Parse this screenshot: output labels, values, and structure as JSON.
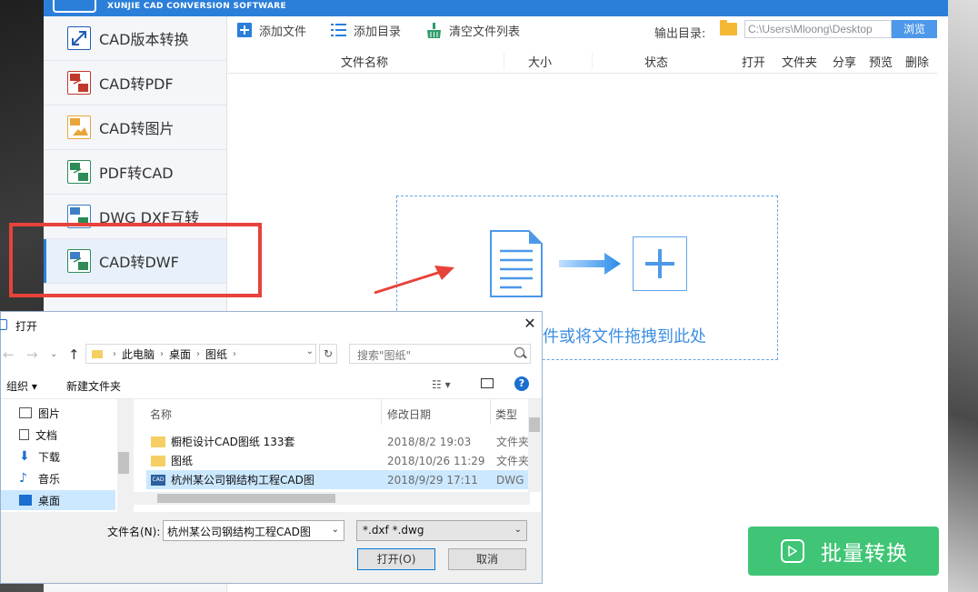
{
  "app": {
    "brand": "XUNJIE CAD CONVERSION SOFTWARE",
    "accent_color": "#2b7fd8"
  },
  "sidebar": {
    "items": [
      {
        "label": "CAD版本转换",
        "icon": "cad-version-icon",
        "icon_text": "",
        "color": "#1f5fb3"
      },
      {
        "label": "CAD转PDF",
        "icon": "cad-to-pdf-icon",
        "icon_text": "CAD PDF",
        "color": "#c0392b"
      },
      {
        "label": "CAD转图片",
        "icon": "cad-to-image-icon",
        "icon_text": "CAD",
        "color": "#e8a53a"
      },
      {
        "label": "PDF转CAD",
        "icon": "pdf-to-cad-icon",
        "icon_text": "PDF CAD",
        "color": "#2e8b57"
      },
      {
        "label": "DWG DXF互转",
        "icon": "dwg-dxf-icon",
        "icon_text": "DWG",
        "color": "#3d7fc4"
      },
      {
        "label": "CAD转DWF",
        "icon": "cad-to-dwf-icon",
        "icon_text": "DWG DWF",
        "color": "#2e8b57",
        "active": true
      }
    ]
  },
  "toolbar": {
    "add_file": "添加文件",
    "add_folder": "添加目录",
    "clear_list": "清空文件列表",
    "output_label": "输出目录:",
    "output_path": "C:\\Users\\Mloong\\Desktop",
    "browse": "浏览"
  },
  "columns": {
    "name": "文件名称",
    "size": "大小",
    "status": "状态",
    "open": "打开",
    "folder": "文件夹",
    "share": "分享",
    "preview": "预览",
    "delete": "删除"
  },
  "drop_zone": {
    "text": "件或将文件拖拽到此处"
  },
  "batch_button": "批量转换",
  "dialog": {
    "title": "打开",
    "breadcrumb": [
      "此电脑",
      "桌面",
      "图纸"
    ],
    "search_placeholder": "搜索\"图纸\"",
    "organize": "组织 ▾",
    "new_folder": "新建文件夹",
    "view_toggle": "▾",
    "help": "?",
    "nav_items": [
      {
        "label": "图片",
        "icon": "pictures-icon"
      },
      {
        "label": "文档",
        "icon": "documents-icon"
      },
      {
        "label": "下载",
        "icon": "downloads-icon"
      },
      {
        "label": "音乐",
        "icon": "music-icon"
      },
      {
        "label": "桌面",
        "icon": "desktop-icon",
        "selected": true
      }
    ],
    "headers": {
      "name": "名称",
      "date": "修改日期",
      "type": "类型"
    },
    "files": [
      {
        "name": "橱柜设计CAD图纸 133套",
        "date": "2018/8/2 19:03",
        "type": "文件夹",
        "icon": "folder-icon"
      },
      {
        "name": "图纸",
        "date": "2018/10/26 11:29",
        "type": "文件夹",
        "icon": "folder-icon"
      },
      {
        "name": "杭州某公司钢结构工程CAD图",
        "date": "2018/9/29 17:11",
        "type": "DWG",
        "icon": "cad-file-icon",
        "selected": true
      }
    ],
    "filename_label": "文件名(N):",
    "filename_value": "杭州某公司钢结构工程CAD图",
    "filetype_value": "*.dxf *.dwg",
    "open_button": "打开(O)",
    "cancel_button": "取消"
  }
}
